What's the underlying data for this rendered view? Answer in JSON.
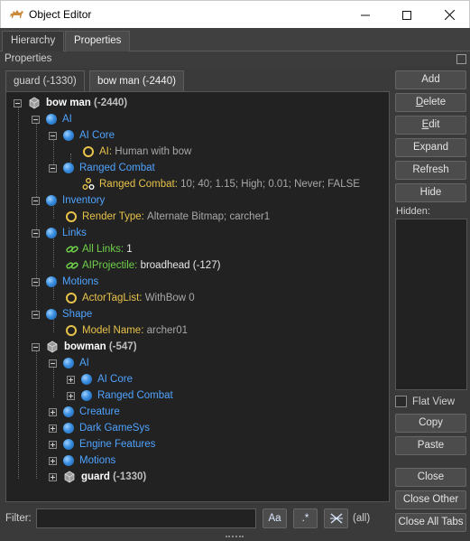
{
  "window": {
    "title": "Object Editor",
    "minimize_glyph": "—",
    "maximize_glyph": "☐",
    "close_glyph": "✕"
  },
  "outer_tabs": [
    {
      "label": "Hierarchy"
    },
    {
      "label": "Properties"
    }
  ],
  "panel": {
    "label": "Properties"
  },
  "inner_tabs": [
    {
      "label": "guard (-1330)"
    },
    {
      "label": "bow man (-2440)"
    }
  ],
  "tree": [
    {
      "kind": "root",
      "name": "bow man",
      "id": "(-2440)"
    },
    {
      "kind": "group",
      "label": "AI"
    },
    {
      "kind": "group",
      "label": "AI Core"
    },
    {
      "kind": "prop",
      "key": "AI:",
      "value": "Human with bow"
    },
    {
      "kind": "group",
      "label": "Ranged Combat"
    },
    {
      "kind": "prop",
      "key": "Ranged Combat:",
      "value": "10; 40; 1.15; High; 0.01; Never; FALSE"
    },
    {
      "kind": "group",
      "label": "Inventory"
    },
    {
      "kind": "prop",
      "key": "Render Type:",
      "value": "Alternate Bitmap; carcher1"
    },
    {
      "kind": "group",
      "label": "Links"
    },
    {
      "kind": "link",
      "key": "All Links:",
      "value": "1"
    },
    {
      "kind": "link",
      "key": "AIProjectile:",
      "value": "broadhead (-127)"
    },
    {
      "kind": "group",
      "label": "Motions"
    },
    {
      "kind": "prop",
      "key": "ActorTagList:",
      "value": "WithBow 0"
    },
    {
      "kind": "group",
      "label": "Shape"
    },
    {
      "kind": "prop",
      "key": "Model Name:",
      "value": "archer01"
    },
    {
      "kind": "root",
      "name": "bowman",
      "id": "(-547)"
    },
    {
      "kind": "group",
      "label": "AI"
    },
    {
      "kind": "group",
      "label": "AI Core"
    },
    {
      "kind": "group",
      "label": "Ranged Combat"
    },
    {
      "kind": "group",
      "label": "Creature"
    },
    {
      "kind": "group",
      "label": "Dark GameSys"
    },
    {
      "kind": "group",
      "label": "Engine Features"
    },
    {
      "kind": "group",
      "label": "Motions"
    },
    {
      "kind": "root",
      "name": "guard",
      "id": "(-1330)"
    }
  ],
  "buttons": {
    "add": "Add",
    "delete": "Delete",
    "edit": "Edit",
    "expand": "Expand",
    "refresh": "Refresh",
    "hide": "Hide",
    "copy": "Copy",
    "paste": "Paste",
    "close": "Close",
    "close_other": "Close Other",
    "close_all_tabs": "Close All Tabs"
  },
  "hidden_label": "Hidden:",
  "flat_view": {
    "label": "Flat View",
    "checked": false
  },
  "filter": {
    "label": "Filter:",
    "value": "",
    "case_btn": "Aa",
    "regex_btn": ".*",
    "all_label": "(all)"
  },
  "colors": {
    "accent_blue": "#4fa3ff",
    "property_key": "#e8c34a",
    "link_key": "#6fd14a",
    "background": "#3a3a3a"
  }
}
